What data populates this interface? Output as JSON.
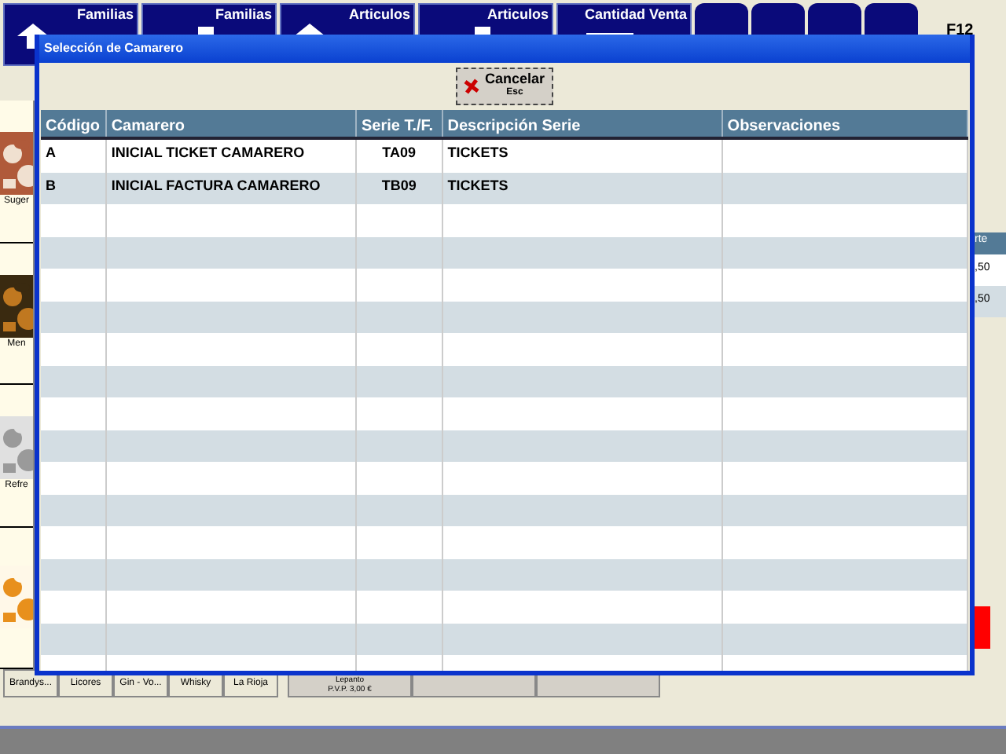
{
  "top_buttons": [
    {
      "label": "Familias",
      "kind": "up"
    },
    {
      "label": "Familias",
      "kind": "down"
    },
    {
      "label": "Articulos",
      "kind": "up"
    },
    {
      "label": "Articulos",
      "kind": "down"
    },
    {
      "label": "Cantidad Venta",
      "kind": "minus"
    }
  ],
  "function_key": "F12",
  "categories": [
    {
      "label": "Suger"
    },
    {
      "label": "Men"
    },
    {
      "label": "Refre"
    }
  ],
  "right_fragments": {
    "header": "rte",
    "values": [
      ",50",
      ",50"
    ]
  },
  "bottom_families": [
    "Brandys...",
    "Licores",
    "Gin - Vo...",
    "Whisky",
    "La Rioja"
  ],
  "bottom_articles": [
    {
      "name": "Lepanto",
      "price": "P.V.P. 3,00 €"
    }
  ],
  "dialog": {
    "title": "Selección de Camarero",
    "cancel_button": {
      "label": "Cancelar",
      "shortcut": "Esc"
    },
    "columns": [
      "Código",
      "Camarero",
      "Serie T./F.",
      "Descripción Serie",
      "Observaciones"
    ],
    "rows": [
      [
        "A",
        "INICIAL TICKET CAMARERO",
        "TA09",
        "TICKETS",
        ""
      ],
      [
        "B",
        "INICIAL FACTURA CAMARERO",
        "TB09",
        "TICKETS",
        ""
      ]
    ]
  }
}
